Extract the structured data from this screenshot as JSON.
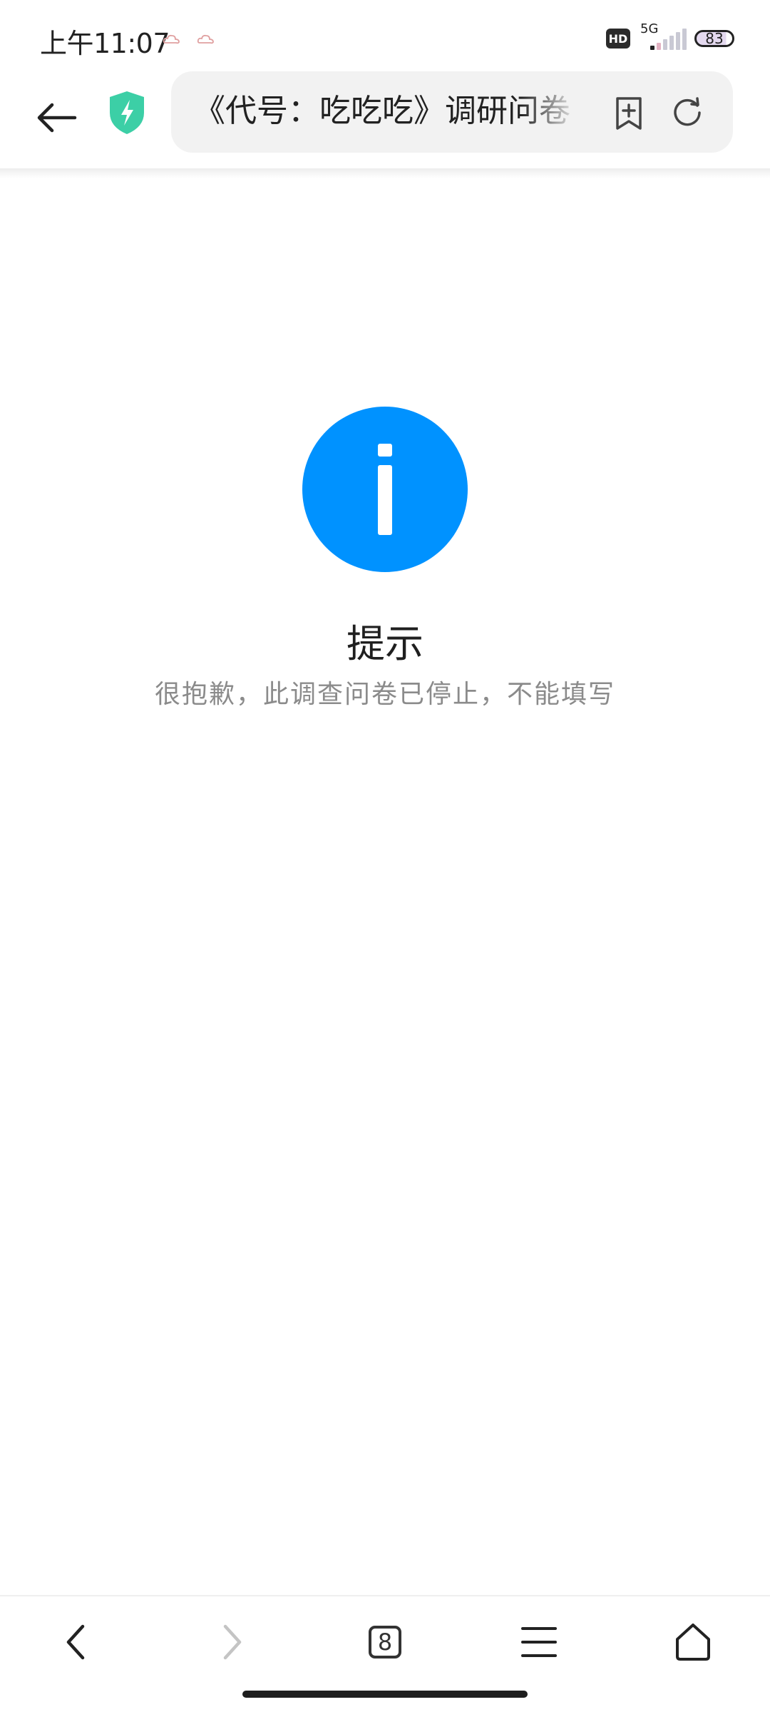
{
  "status_bar": {
    "time": "上午11:07",
    "hd_badge": "HD",
    "network": "5G",
    "battery": "83"
  },
  "browser": {
    "url_title": "《代号：吃吃吃》调研问卷",
    "tabs_count": "8"
  },
  "message": {
    "title": "提示",
    "text": "很抱歉，此调查问卷已停止，不能填写"
  },
  "colors": {
    "info_accent": "#0092ff",
    "shield_accent": "#3ccfa6"
  }
}
